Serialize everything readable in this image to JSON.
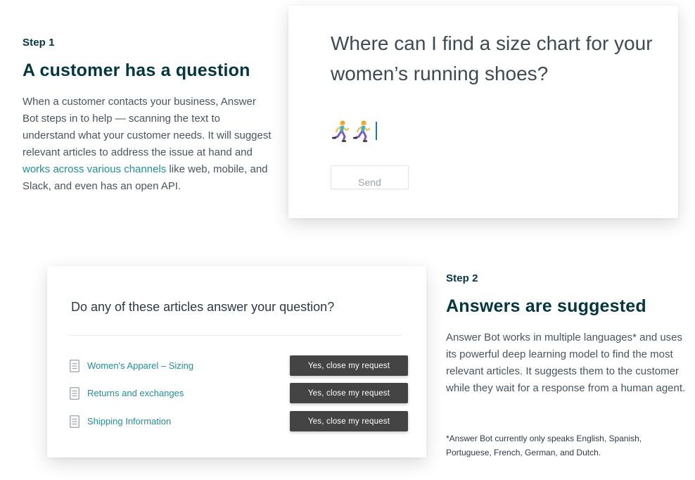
{
  "step1": {
    "label": "Step 1",
    "heading": "A customer has a question",
    "body_before_link": "When a customer contacts your business, Answer Bot steps in to help — scanning the text to understand what your customer needs. It will suggest relevant articles to address the issue at hand and ",
    "link_text": "works across various channels",
    "body_after_link": " like web, mobile, and Slack, and even has an open API."
  },
  "question_card": {
    "question": "Where can I find a size chart for your women’s running shoes?",
    "emoji_icons": [
      "runner-icon",
      "runner-icon"
    ],
    "send_label": "Send"
  },
  "suggestion_card": {
    "title": "Do any of these articles answer your question?",
    "articles": [
      {
        "title": "Women's Apparel – Sizing",
        "button_label": "Yes, close my request"
      },
      {
        "title": "Returns and exchanges",
        "button_label": "Yes, close my request"
      },
      {
        "title": "Shipping Information",
        "button_label": "Yes, close my request"
      }
    ]
  },
  "step2": {
    "label": "Step 2",
    "heading": "Answers are suggested",
    "body": "Answer Bot works in multiple languages* and uses its powerful deep learning model to find the most relevant articles. It suggests them to the customer while they wait for a response from a human agent.",
    "footnote": "*Answer Bot currently only speaks English, Spanish, Portuguese, French, German, and Dutch."
  },
  "colors": {
    "heading": "#03363d",
    "link": "#228f95",
    "button_dark": "#444444"
  }
}
